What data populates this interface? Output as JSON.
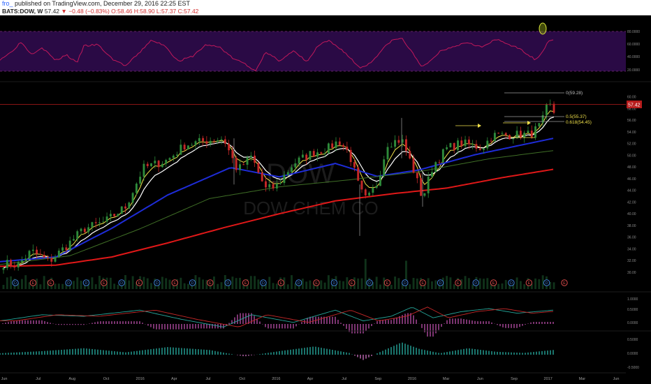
{
  "header": {
    "user": "fro_",
    "published": "published on TradingView.com, December 29, 2016 22:25 EST",
    "symbol": "BATS:DOW, W",
    "last": "57.42",
    "change": "▼ −0.48 (−0.83%)",
    "ohlc": "O:58.46 H:58.90 L:57.37 C:57.42"
  },
  "watermark": {
    "ticker": "DOW",
    "name": "DOW CHEM CO"
  },
  "colors": {
    "background": "#000000",
    "rsi_band": "#2a0a45",
    "rsi_line": "#c2185b",
    "candle_up": "#2e8b3a",
    "candle_down": "#c62828",
    "ema_fast": "#f0e04a",
    "ema_mid": "#ffffff",
    "ema_blue": "#1e2cd8",
    "ema_green": "#3f6e26",
    "ema_red": "#e01818",
    "earnings": "#d84a4a",
    "dividend": "#3f7fd8"
  },
  "chart_data": {
    "type": "candlestick",
    "ylim": [
      29.5,
      62.0
    ],
    "price_ticks": [
      "60.00",
      "58.00",
      "56.00",
      "54.00",
      "52.00",
      "50.00",
      "48.00",
      "46.00",
      "44.00",
      "42.00",
      "40.00",
      "38.00",
      "36.00",
      "34.00",
      "32.00",
      "30.00"
    ],
    "last_price_label": "57.42",
    "x_labels": [
      "Jun",
      "Jul",
      "Aug",
      "Oct",
      "2016",
      "Apr",
      "Jul",
      "Oct",
      "2016",
      "Apr",
      "Jul",
      "Sep",
      "2016",
      "Mar",
      "Jun",
      "Sep",
      "2017",
      "Mar",
      "Jun"
    ],
    "fib_levels": [
      {
        "label": "0(59.28)",
        "value": 59.28
      },
      {
        "label": "0.5(55.37)",
        "value": 55.37
      },
      {
        "label": "0.618(54.45)",
        "value": 54.45
      }
    ],
    "rsi": {
      "ticks": [
        "80.0000",
        "60.0000",
        "40.0000",
        "20.0000"
      ],
      "band": [
        30,
        70
      ]
    },
    "macd": {
      "ticks": [
        "1.0000",
        "0.5000",
        "0.0000"
      ]
    },
    "oscillator": {
      "ticks": [
        "0.5000",
        "0.0000",
        "-0.5000"
      ]
    },
    "events": [
      "D",
      "E",
      "E",
      "D",
      "D",
      "E",
      "D",
      "E",
      "D",
      "E",
      "D",
      "E",
      "D",
      "E",
      "D",
      "E",
      "D",
      "E",
      "D",
      "E",
      "D",
      "E",
      "D",
      "E",
      "D",
      "E",
      "D",
      "E",
      "D",
      "E",
      "D",
      "E"
    ]
  }
}
